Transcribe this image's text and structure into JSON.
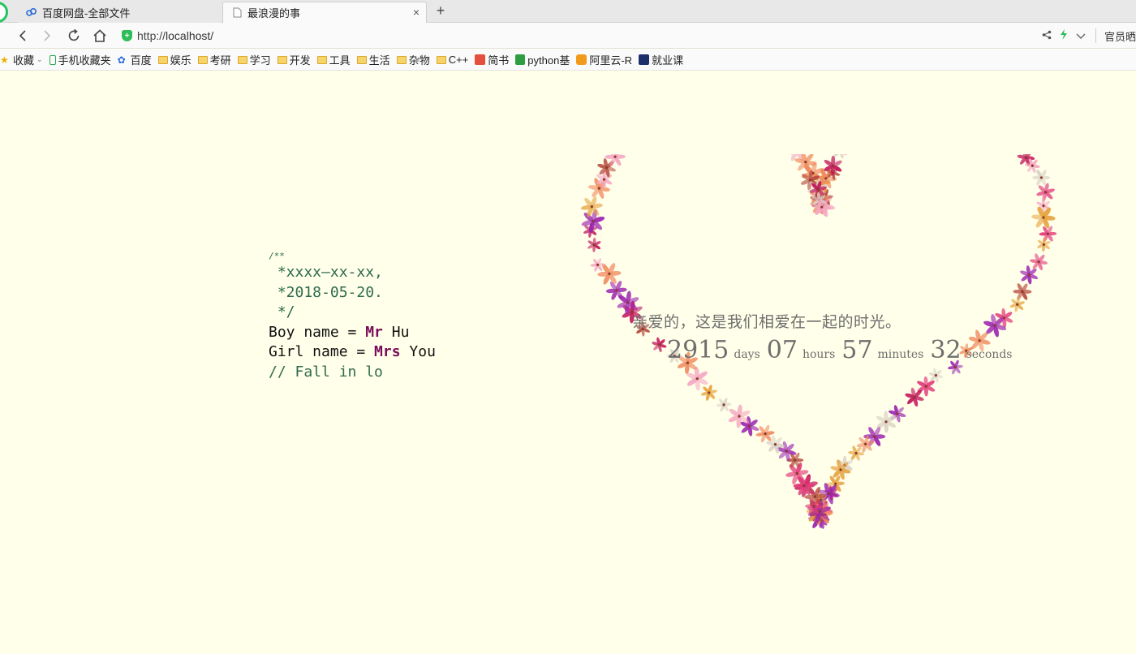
{
  "browser": {
    "tabs": [
      {
        "label": "百度网盘-全部文件",
        "active": false,
        "icon": "baidu-cloud-icon"
      },
      {
        "label": "最浪漫的事",
        "active": true,
        "icon": "page-icon"
      }
    ],
    "new_tab_label": "+",
    "close_label": "×",
    "url_protocol": "http://",
    "url_host": "localhost/",
    "nav_right_text": "官员晒"
  },
  "bookmarks": [
    {
      "label": "收藏",
      "icon": "star-folder-icon",
      "dropdown": true
    },
    {
      "label": "手机收藏夹",
      "icon": "phone-icon"
    },
    {
      "label": "百度",
      "icon": "baidu-paw-icon"
    },
    {
      "label": "娱乐",
      "icon": "folder-icon"
    },
    {
      "label": "考研",
      "icon": "folder-icon"
    },
    {
      "label": "学习",
      "icon": "folder-icon"
    },
    {
      "label": "开发",
      "icon": "folder-icon"
    },
    {
      "label": "工具",
      "icon": "folder-icon"
    },
    {
      "label": "生活",
      "icon": "folder-icon"
    },
    {
      "label": "杂物",
      "icon": "folder-icon"
    },
    {
      "label": "C++",
      "icon": "folder-icon"
    },
    {
      "label": "简书",
      "icon": "jianshu-icon"
    },
    {
      "label": "python基",
      "icon": "python-book-icon"
    },
    {
      "label": "阿里云-R",
      "icon": "aliyun-icon"
    },
    {
      "label": "就业课",
      "icon": "course-icon"
    }
  ],
  "code": {
    "line0": "/**",
    "line1": " *xxxx—xx-xx,",
    "line2": " *2018-05-20.",
    "line3": " */",
    "boy_prefix": "Boy name = ",
    "boy_kw": "Mr",
    "boy_name": " Hu",
    "girl_prefix": "Girl name = ",
    "girl_kw": "Mrs",
    "girl_name": " You",
    "line6": "// Fall in lo"
  },
  "love": {
    "words": "亲爱的，这是我们相爱在一起的时光。",
    "days": "2915",
    "days_unit": "days",
    "hours": "07",
    "hours_unit": "hours",
    "minutes": "57",
    "minutes_unit": "minutes",
    "seconds": "32",
    "seconds_unit": "seconds"
  },
  "colors": {
    "page_background": "#ffffea",
    "code_comment": "#2e6b4e",
    "code_keyword": "#7a0d5a",
    "heart_petals": [
      "#e23a7a",
      "#f08a5d",
      "#c2185b",
      "#f4a6c0",
      "#b5473a",
      "#e6a23c",
      "#9c27b0",
      "#d9d2c5"
    ]
  }
}
